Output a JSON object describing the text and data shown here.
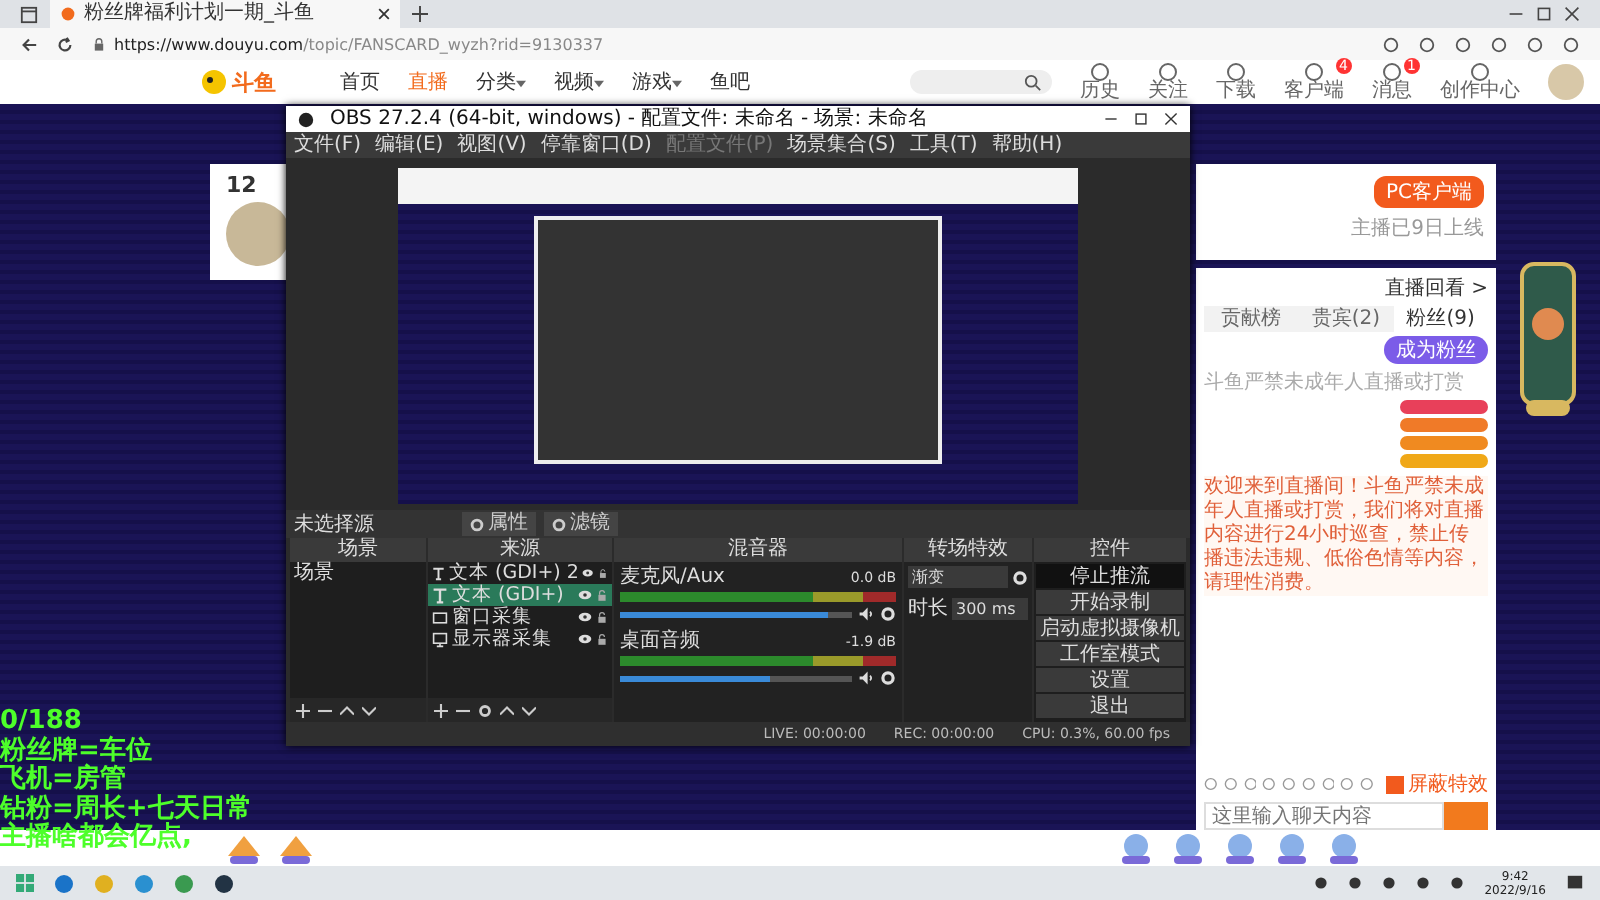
{
  "browser": {
    "tab_title": "粉丝牌福利计划一期_斗鱼",
    "url_host": "https://www.douyu.com",
    "url_path": "/topic/FANSCARD_wyzh?rid=9130337"
  },
  "site_nav": {
    "logo": "斗鱼",
    "items": [
      {
        "label": "首页",
        "selected": false,
        "menu": false
      },
      {
        "label": "直播",
        "selected": true,
        "menu": false
      },
      {
        "label": "分类",
        "selected": false,
        "menu": true
      },
      {
        "label": "视频",
        "selected": false,
        "menu": true
      },
      {
        "label": "游戏",
        "selected": false,
        "menu": true
      },
      {
        "label": "鱼吧",
        "selected": false,
        "menu": false
      }
    ],
    "tools": [
      {
        "label": "历史"
      },
      {
        "label": "关注"
      },
      {
        "label": "下载"
      },
      {
        "label": "客户端",
        "badge": "4"
      },
      {
        "label": "消息",
        "badge": "1"
      },
      {
        "label": "创作中心"
      }
    ]
  },
  "room_card": {
    "count": "12"
  },
  "client_card": {
    "button": "PC客户端",
    "note": "主播已9日上线"
  },
  "obs": {
    "title": "OBS 27.2.4 (64-bit, windows) - 配置文件: 未命名 - 场景: 未命名",
    "menu": [
      {
        "label": "文件(F)",
        "disabled": false
      },
      {
        "label": "编辑(E)",
        "disabled": false
      },
      {
        "label": "视图(V)",
        "disabled": false
      },
      {
        "label": "停靠窗口(D)",
        "disabled": false
      },
      {
        "label": "配置文件(P)",
        "disabled": true
      },
      {
        "label": "场景集合(S)",
        "disabled": false
      },
      {
        "label": "工具(T)",
        "disabled": false
      },
      {
        "label": "帮助(H)",
        "disabled": false
      }
    ],
    "source_bar": {
      "label": "未选择源",
      "buttons": [
        "属性",
        "滤镜"
      ]
    },
    "scenes": {
      "title": "场景",
      "items": [
        {
          "name": "场景",
          "selected": false
        }
      ]
    },
    "sources": {
      "title": "来源",
      "items": [
        {
          "kind": "text",
          "name": "文本 (GDI+) 2",
          "selected": false
        },
        {
          "kind": "text",
          "name": "文本 (GDI+)",
          "selected": true
        },
        {
          "kind": "window",
          "name": "窗口采集",
          "selected": false
        },
        {
          "kind": "monitor",
          "name": "显示器采集",
          "selected": false
        }
      ]
    },
    "mixer": {
      "title": "混音器",
      "channels": [
        {
          "name": "麦克风/Aux",
          "reading": "0.0 dB",
          "level": 0.9
        },
        {
          "name": "桌面音频",
          "reading": "-1.9 dB",
          "level": 0.65
        }
      ]
    },
    "transitions": {
      "title": "转场特效",
      "transition": "渐变",
      "duration_label": "时长",
      "duration": "300 ms"
    },
    "controls": {
      "title": "控件",
      "buttons": [
        {
          "label": "停止推流",
          "active": true
        },
        {
          "label": "开始录制",
          "active": false
        },
        {
          "label": "启动虚拟摄像机",
          "active": false
        },
        {
          "label": "工作室模式",
          "active": false
        },
        {
          "label": "设置",
          "active": false
        },
        {
          "label": "退出",
          "active": false
        }
      ]
    },
    "status": {
      "live": "LIVE: 00:00:00",
      "rec": "REC: 00:00:00",
      "cpu": "CPU: 0.3%, 60.00 fps"
    }
  },
  "chat": {
    "replay": "直播回看 >",
    "tabs": [
      {
        "label": "贡献榜",
        "selected": false
      },
      {
        "label": "贵宾(2)",
        "selected": false
      },
      {
        "label": "粉丝(9)",
        "selected": true
      }
    ],
    "join_button": "成为粉丝",
    "notice_small": "斗鱼严禁未成年人直播或打赏",
    "ranks": [
      {
        "color": "#e8405a"
      },
      {
        "color": "#f07a28"
      },
      {
        "color": "#f08a20"
      },
      {
        "color": "#f0a818"
      }
    ],
    "notice": "欢迎来到直播间！斗鱼严禁未成年人直播或打赏，我们将对直播内容进行24小时巡查，禁止传播违法违规、低俗色情等内容，请理性消费。",
    "block_effects": {
      "label": "屏蔽特效",
      "checked": true
    },
    "input": {
      "placeholder": "这里输入聊天内容"
    }
  },
  "overlay_lines": [
    "0/188",
    "粉丝牌=车位",
    "飞机=房管",
    "钻粉=周长+七天日常",
    "主播啥都会亿点,"
  ],
  "taskbar": {
    "time": "9:42",
    "date": "2022/9/16"
  }
}
